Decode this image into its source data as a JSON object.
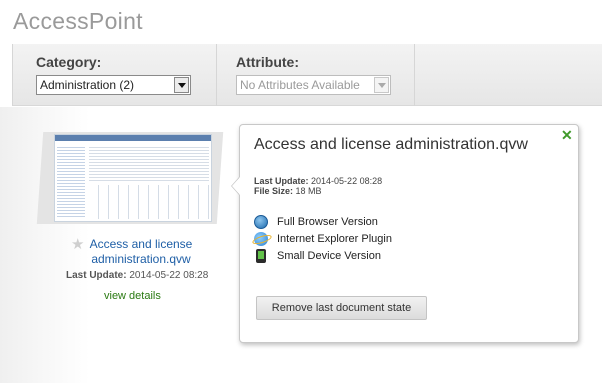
{
  "app": {
    "title": "AccessPoint"
  },
  "filters": {
    "category": {
      "label": "Category:",
      "value": "Administration (2)"
    },
    "attribute": {
      "label": "Attribute:",
      "value": "No Attributes Available"
    }
  },
  "document": {
    "title_line1": "Access and license",
    "title_line2": "administration.qvw",
    "last_update_label": "Last Update:",
    "last_update_value": "2014-05-22 08:28",
    "view_details": "view details"
  },
  "popup": {
    "title": "Access and license administration.qvw",
    "last_update_label": "Last Update:",
    "last_update_value": "2014-05-22 08:28",
    "file_size_label": "File Size:",
    "file_size_value": "18 MB",
    "options": [
      {
        "label": "Full Browser Version",
        "icon": "globe-icon"
      },
      {
        "label": "Internet Explorer Plugin",
        "icon": "ie-icon"
      },
      {
        "label": "Small Device Version",
        "icon": "mobile-device-icon"
      }
    ],
    "remove_button": "Remove last document state",
    "close_glyph": "✕"
  },
  "icons": {
    "favorite": "star-icon",
    "close": "close-icon"
  },
  "colors": {
    "link": "#1f5fa6",
    "view_details": "#2a7a12",
    "close": "#3f9a2a"
  }
}
